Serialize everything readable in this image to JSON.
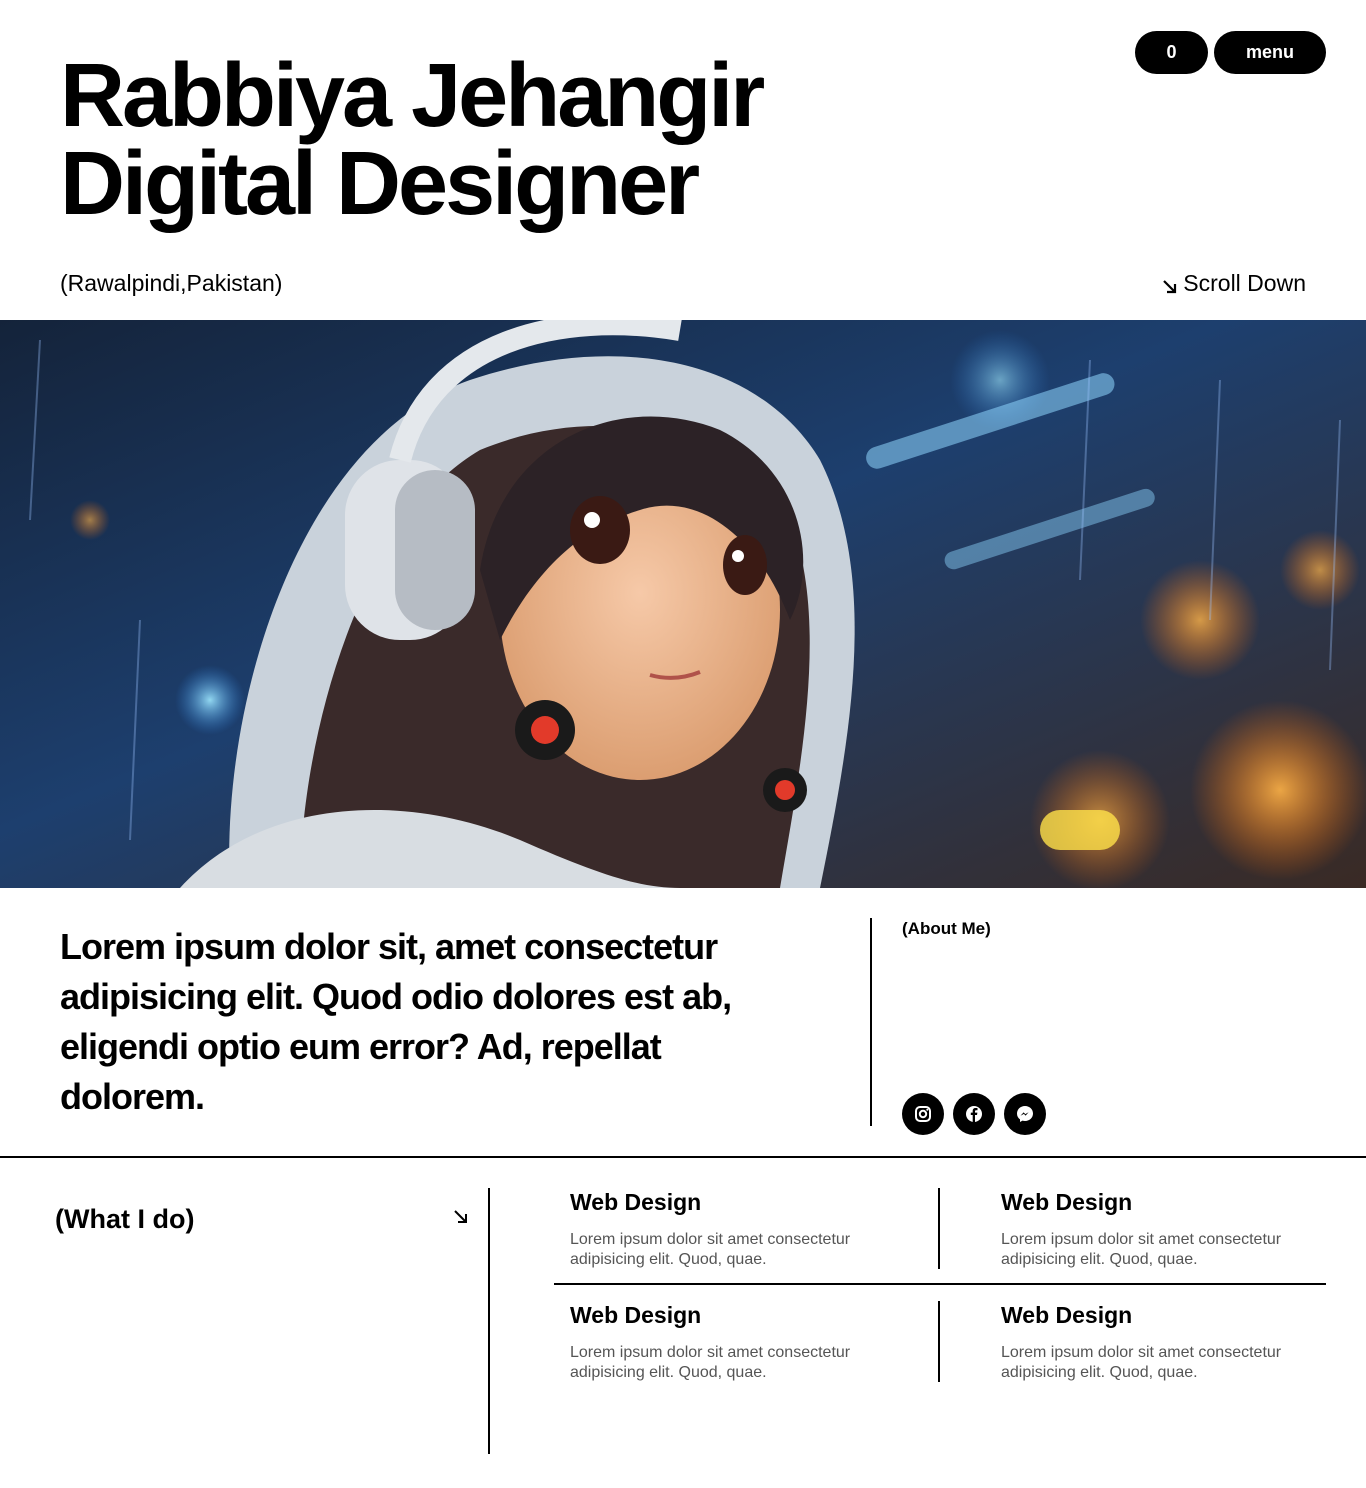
{
  "header": {
    "title_line1": "Rabbiya Jehangir",
    "title_line2": "Digital Designer",
    "count_label": "0",
    "menu_label": "menu",
    "location": "(Rawalpindi,Pakistan)",
    "scroll_label": "Scroll Down"
  },
  "hero": {
    "image_alt": "anime girl with headphones"
  },
  "about": {
    "text": "Lorem ipsum dolor sit, amet consectetur adipisicing elit. Quod odio dolores est ab, eligendi optio eum error? Ad, repellat dolorem.",
    "label": "(About Me)",
    "socials": [
      "instagram-icon",
      "facebook-icon",
      "messenger-icon"
    ]
  },
  "services": {
    "label": "(What I do)",
    "items": [
      {
        "title": "Web Design",
        "desc": "Lorem ipsum dolor sit amet consectetur adipisicing elit. Quod, quae."
      },
      {
        "title": "Web Design",
        "desc": "Lorem ipsum dolor sit amet consectetur adipisicing elit. Quod, quae."
      },
      {
        "title": "Web Design",
        "desc": "Lorem ipsum dolor sit amet consectetur adipisicing elit. Quod, quae."
      },
      {
        "title": "Web Design",
        "desc": "Lorem ipsum dolor sit amet consectetur adipisicing elit. Quod, quae."
      }
    ]
  },
  "colors": {
    "text": "#000000",
    "muted": "#555555",
    "background": "#ffffff"
  }
}
